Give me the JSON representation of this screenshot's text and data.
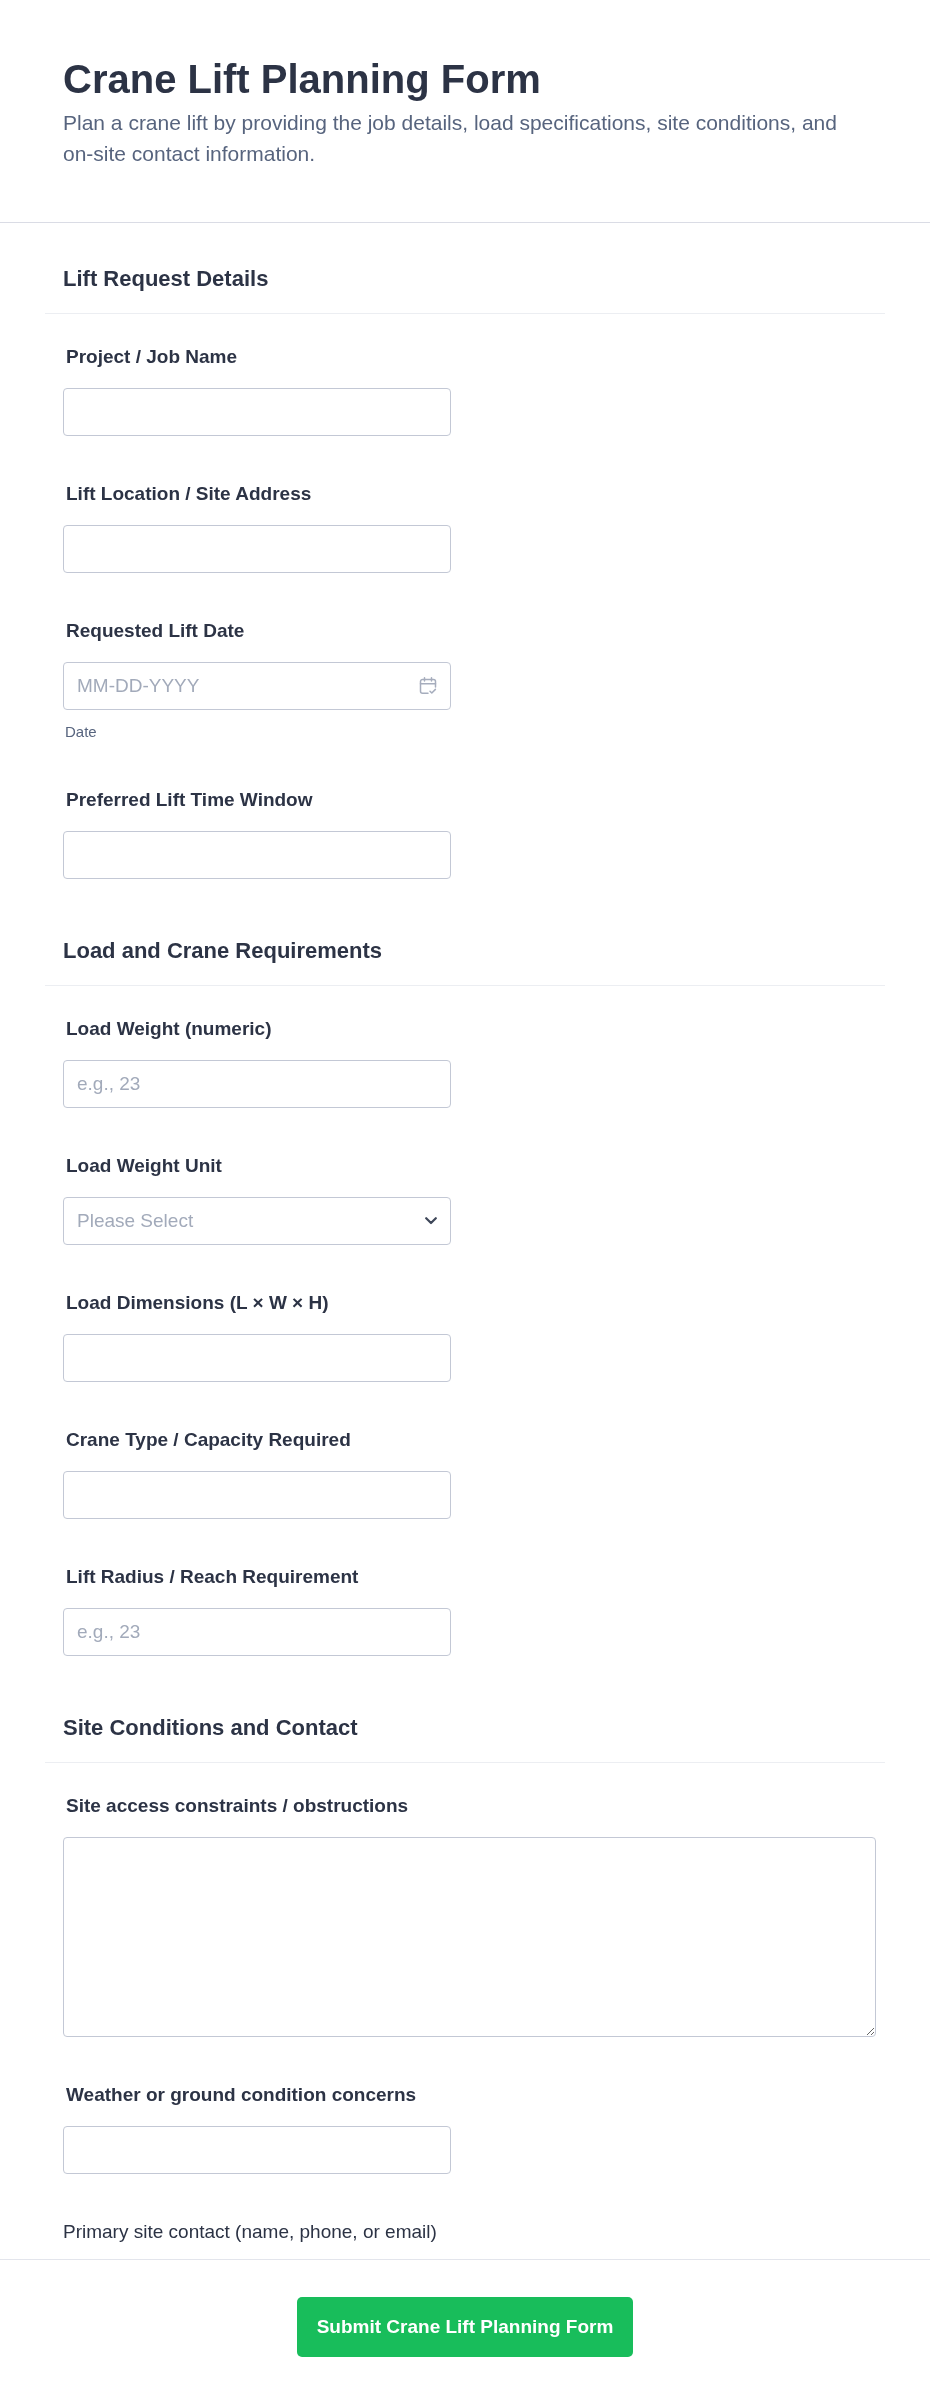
{
  "header": {
    "title": "Crane Lift Planning Form",
    "description": "Plan a crane lift by providing the job details, load specifications, site conditions, and on-site contact information."
  },
  "sections": [
    {
      "title": "Lift Request Details",
      "fields": [
        {
          "kind": "text",
          "label": "Project / Job Name"
        },
        {
          "kind": "text",
          "label": "Lift Location / Site Address"
        },
        {
          "kind": "date",
          "label": "Requested Lift Date",
          "placeholder": "MM-DD-YYYY",
          "sublabel": "Date"
        },
        {
          "kind": "text",
          "label": "Preferred Lift Time Window"
        }
      ]
    },
    {
      "title": "Load and Crane Requirements",
      "fields": [
        {
          "kind": "number",
          "label": "Load Weight (numeric)",
          "placeholder": "e.g., 23"
        },
        {
          "kind": "select",
          "label": "Load Weight Unit",
          "placeholder": "Please Select"
        },
        {
          "kind": "text",
          "label": "Load Dimensions (L × W × H)"
        },
        {
          "kind": "text",
          "label": "Crane Type / Capacity Required"
        },
        {
          "kind": "number",
          "label": "Lift Radius / Reach Requirement",
          "placeholder": "e.g., 23"
        }
      ]
    },
    {
      "title": "Site Conditions and Contact",
      "fields": [
        {
          "kind": "textarea",
          "label": "Site access constraints / obstructions"
        },
        {
          "kind": "text",
          "label": "Weather or ground condition concerns"
        },
        {
          "kind": "caption",
          "label": "Primary site contact (name, phone, or email)"
        }
      ]
    }
  ],
  "submit_button": {
    "label": "Submit Crane Lift Planning Form"
  }
}
